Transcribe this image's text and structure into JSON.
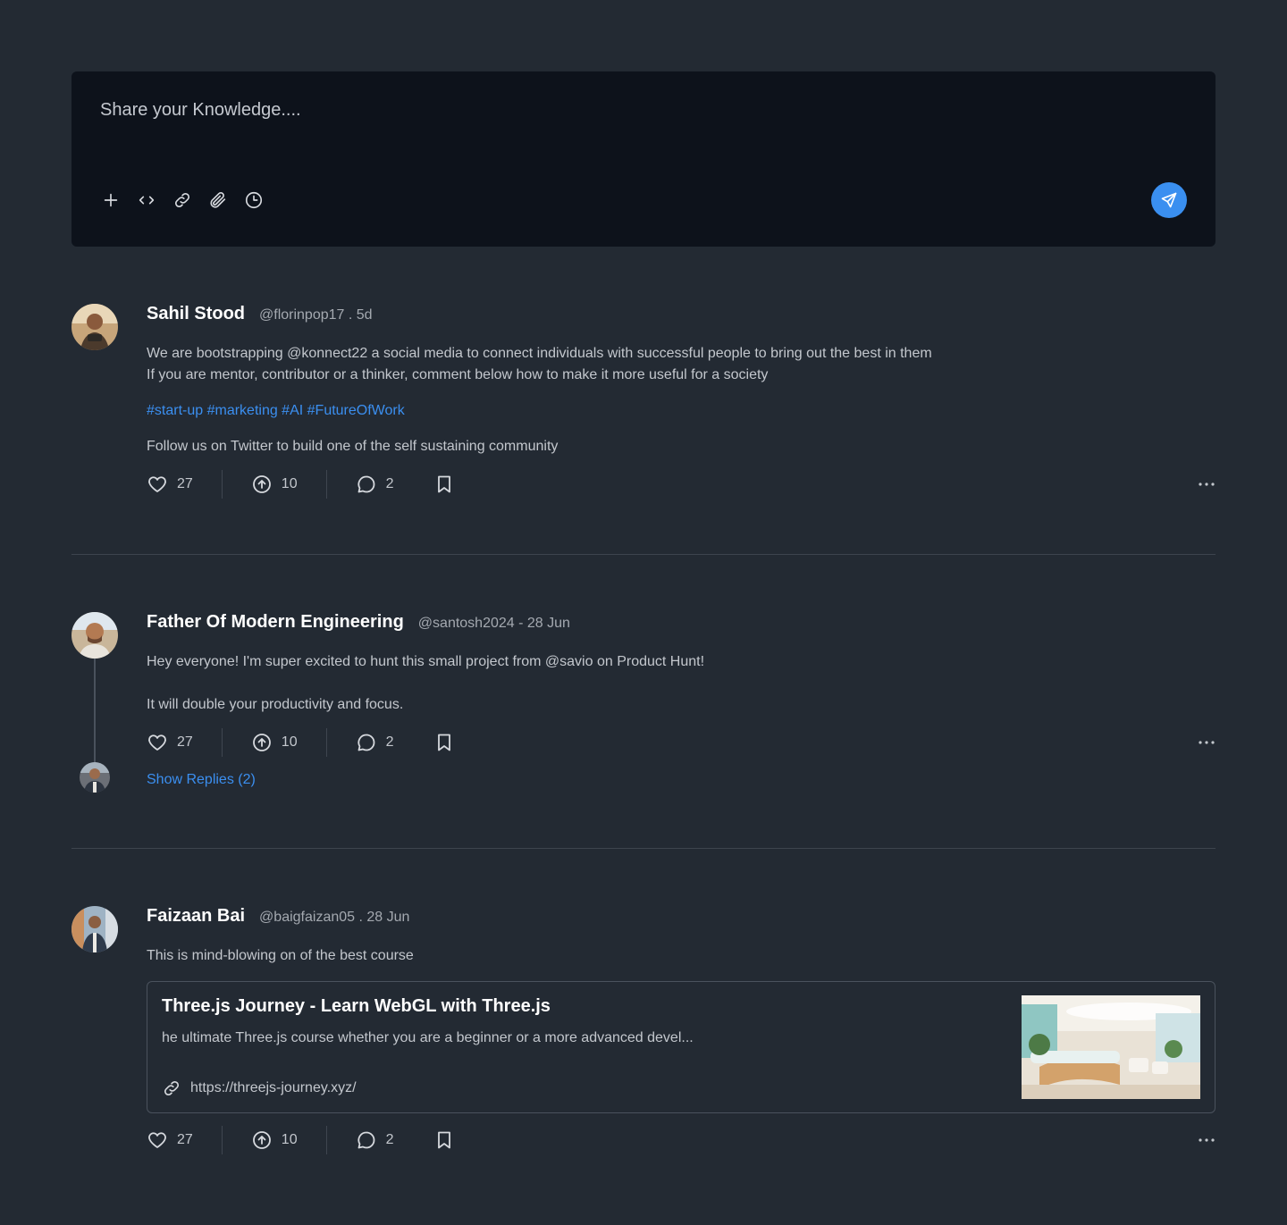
{
  "composer": {
    "placeholder": "Share your Knowledge....",
    "tools": [
      "plus-icon",
      "code-icon",
      "link-icon",
      "paperclip-icon",
      "clock-icon"
    ],
    "send_icon": "send-icon",
    "accent": "#3a8ff0"
  },
  "posts": [
    {
      "author": "Sahil Stood",
      "meta": "@florinpop17 . 5d",
      "lines": [
        "We are bootstrapping @konnect22 a social media to connect individuals with successful people to bring out the best in them",
        "If you are mentor, contributor or a thinker, comment below how to make it more useful for a society"
      ],
      "tags": "#start-up #marketing #AI #FutureOfWork",
      "footer_text": "Follow us on Twitter to build one of the self sustaining community",
      "likes": "27",
      "upvotes": "10",
      "comments": "2"
    },
    {
      "author": "Father Of Modern Engineering",
      "meta": "@santosh2024 - 28 Jun",
      "line1": "Hey everyone! I'm super excited to hunt this small project from @savio on Product Hunt!",
      "line2": "It will double your productivity and focus.",
      "likes": "27",
      "upvotes": "10",
      "comments": "2",
      "show_replies": "Show Replies (2)"
    },
    {
      "author": "Faizaan Bai",
      "meta": "@baigfaizan05 . 28 Jun",
      "text": "This is mind-blowing on of the best course",
      "link_card": {
        "title": "Three.js Journey - Learn WebGL with Three.js",
        "description": "he ultimate Three.js course whether you are a beginner or a more advanced devel...",
        "url": "https://threejs-journey.xyz/"
      },
      "likes": "27",
      "upvotes": "10",
      "comments": "2"
    }
  ],
  "colors": {
    "background": "#232a33",
    "composer_bg": "#0d121b",
    "link": "#3b8ff0"
  }
}
